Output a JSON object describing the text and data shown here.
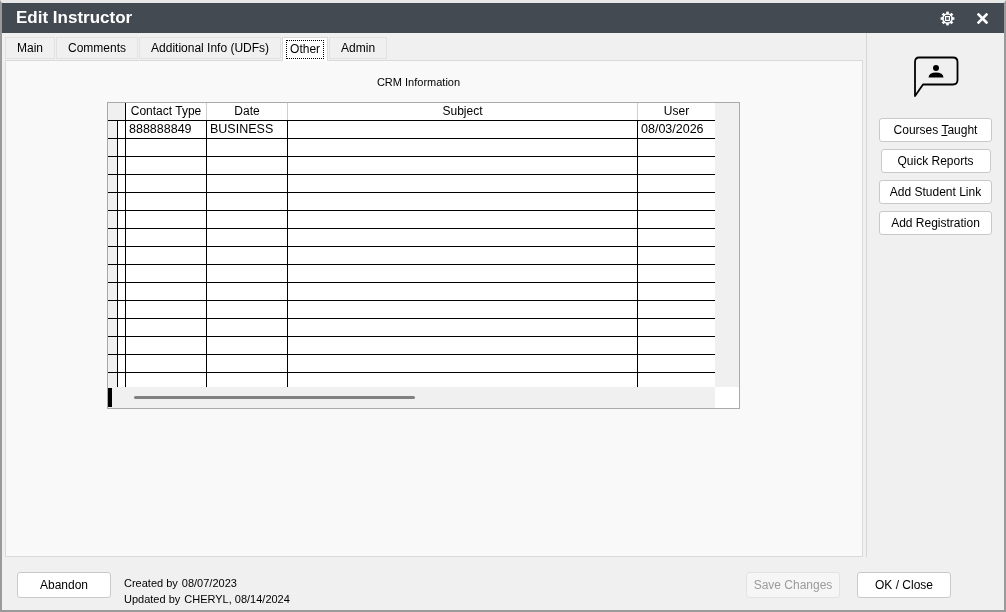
{
  "window": {
    "title": "Edit Instructor"
  },
  "tabs": [
    {
      "label": "Main",
      "selected": false
    },
    {
      "label": "Comments",
      "selected": false
    },
    {
      "label": "Additional Info (UDFs)",
      "selected": false
    },
    {
      "label": "Other",
      "selected": true
    },
    {
      "label": "Admin",
      "selected": false
    }
  ],
  "crm": {
    "title": "CRM Information",
    "columns": [
      "Contact Type",
      "Date",
      "Subject",
      "User"
    ],
    "rows": [
      {
        "contact_type": "888888849",
        "date": "BUSINESS",
        "user": "08/03/2026"
      }
    ]
  },
  "side_buttons": [
    {
      "text_before": "Courses ",
      "access_key": "T",
      "text_after": "aught"
    },
    {
      "label": "Quick Reports"
    },
    {
      "label": "Add Student Link"
    },
    {
      "label": "Add Registration"
    }
  ],
  "footer": {
    "left_buttons": [
      {
        "label": "Abandon",
        "disabled": false
      }
    ],
    "created": {
      "label": "Created by",
      "value": "08/07/2023"
    },
    "updated": {
      "label": "Updated by",
      "value": "CHERYL, 08/14/2024"
    },
    "right_buttons": [
      {
        "label": "Save Changes",
        "disabled": true
      },
      {
        "label": "OK / Close",
        "disabled": false
      }
    ]
  }
}
